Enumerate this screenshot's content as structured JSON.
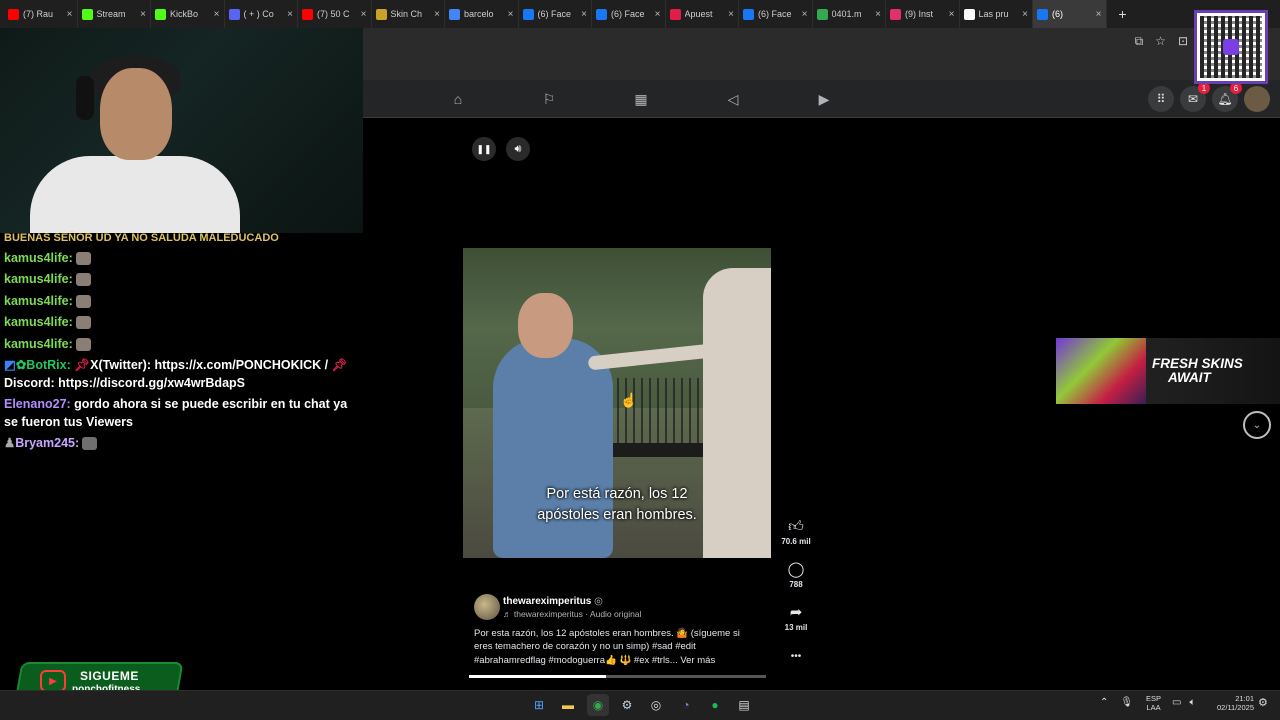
{
  "browser": {
    "tabs": [
      {
        "label": "(7) Rau",
        "icon_color": "#ff0000",
        "icon": "youtube-icon"
      },
      {
        "label": "Stream",
        "icon_color": "#53fc18",
        "icon": "kick-icon"
      },
      {
        "label": "KickBo",
        "icon_color": "#53fc18",
        "icon": "kick-icon"
      },
      {
        "label": "( + ) Co",
        "icon_color": "#5865f2",
        "icon": "discord-icon"
      },
      {
        "label": "(7) 50 C",
        "icon_color": "#ff0000",
        "icon": "youtube-icon"
      },
      {
        "label": "Skin Ch",
        "icon_color": "#c9a227",
        "icon": "skin-icon"
      },
      {
        "label": "barcelo",
        "icon_color": "#4285f4",
        "icon": "google-icon"
      },
      {
        "label": "(6) Face",
        "icon_color": "#1877f2",
        "icon": "facebook-icon"
      },
      {
        "label": "(6) Face",
        "icon_color": "#1877f2",
        "icon": "facebook-icon"
      },
      {
        "label": "Apuest",
        "icon_color": "#e11d48",
        "icon": "bet-icon"
      },
      {
        "label": "(6) Face",
        "icon_color": "#1877f2",
        "icon": "facebook-icon"
      },
      {
        "label": "0401.m",
        "icon_color": "#34a853",
        "icon": "drive-icon"
      },
      {
        "label": "(9) Inst",
        "icon_color": "#e1306c",
        "icon": "instagram-icon"
      },
      {
        "label": "Las pru",
        "icon_color": "#ffffff",
        "icon": "tiktok-icon"
      },
      {
        "label": "(6)",
        "icon_color": "#1877f2",
        "icon": "facebook-icon",
        "active": true
      }
    ],
    "new_tab": "+"
  },
  "chat": {
    "truncated_top": "BUENAS SEÑOR UD YA NO SALUDA MALEDUCADO",
    "messages": [
      {
        "user": "kamus4life:"
      },
      {
        "user": "kamus4life:"
      },
      {
        "user": "kamus4life:"
      },
      {
        "user": "kamus4life:"
      },
      {
        "user": "kamus4life:"
      }
    ],
    "bot": {
      "name": "BotRix:",
      "line1": "X(Twitter): https://x.com/PONCHOKICK /",
      "line2": "Discord: https://discord.gg/xw4wrBdapS"
    },
    "elenano": {
      "name": "Elenano27:",
      "text1": "gordo ahora si se puede escribir en tu chat ya",
      "text2": "se fueron tus Viewers"
    },
    "bryam": {
      "name": "Bryam245:"
    }
  },
  "overlay": {
    "follow_title": "SIGUEME",
    "follow_handle": "ponchofitness"
  },
  "reel": {
    "subtitle_line1": "Por está razón, los 12",
    "subtitle_line2": "apóstoles eran hombres.",
    "likes": "70.6 mil",
    "comments": "788",
    "shares": "13 mil",
    "more": "•••",
    "author": "thewareximperitus",
    "audio": "♬ thewareximperitus · Audio original",
    "caption": "Por esta razón, los 12 apóstoles eran hombres. 🤷 (sígueme si eres temachero de corazón y no un simp) #sad #edit #abrahamredflag #modoguerra👍 🔱 #ex #trls... Ver más",
    "progress": 0.46
  },
  "ad": {
    "line1": "FRESH SKINS",
    "line2": "AWAIT"
  },
  "header": {
    "messenger_badge": "1",
    "notif_badge": "6"
  },
  "taskbar": {
    "lang_line1": "ESP",
    "lang_line2": "LAA",
    "time": "21:01",
    "date": "02/11/2025"
  },
  "colors": {
    "fb_bg": "#242526",
    "accent_green": "#7ed957",
    "bot_green": "#22c55e",
    "ad_purple": "#7c3aed"
  }
}
